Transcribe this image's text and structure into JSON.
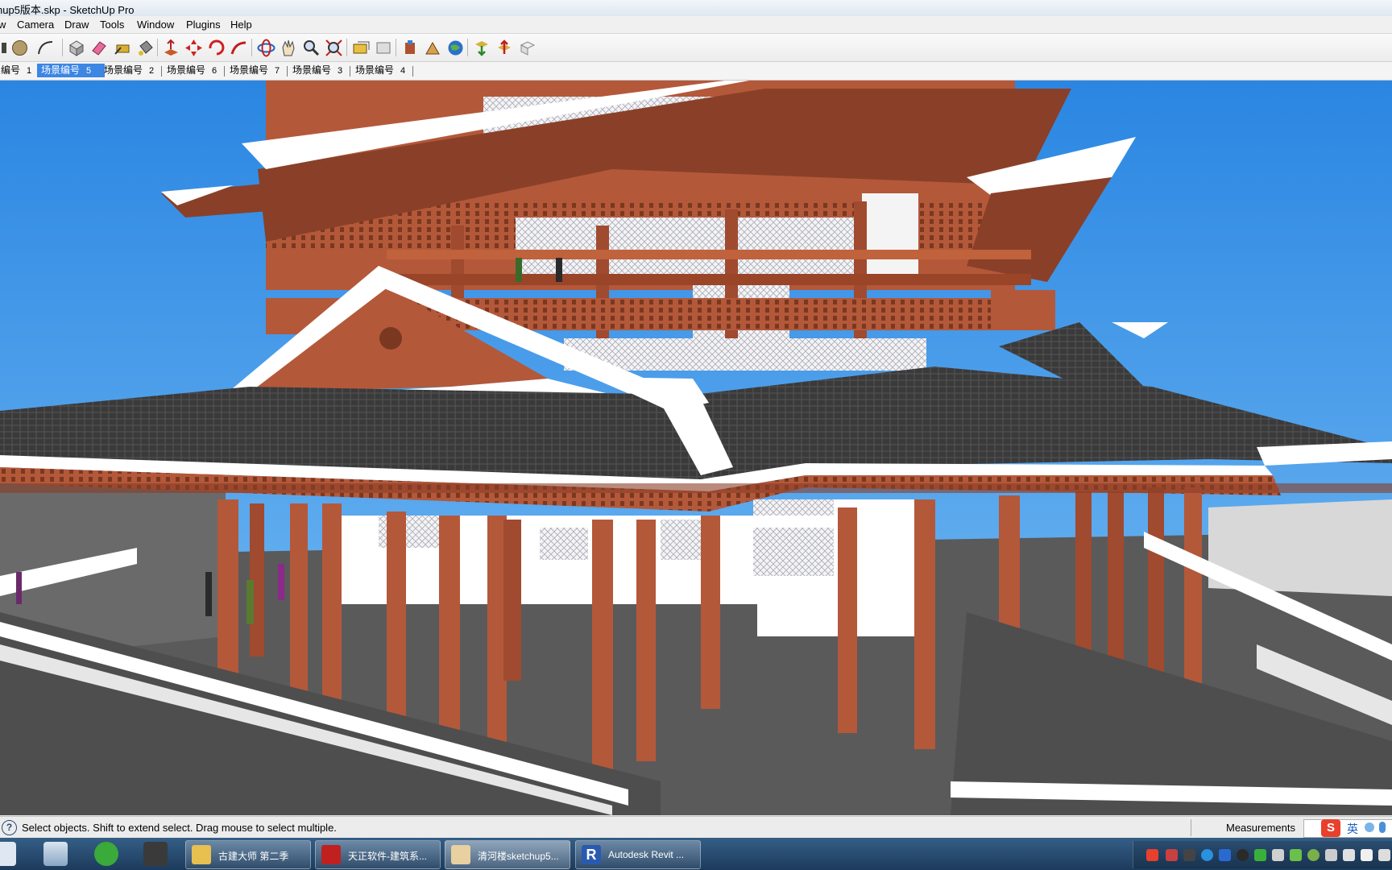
{
  "window": {
    "title": "hup5版本.skp - SketchUp Pro"
  },
  "menu": [
    "w",
    "Camera",
    "Draw",
    "Tools",
    "Window",
    "Plugins",
    "Help"
  ],
  "toolbar": {
    "icons": [
      "circle-tool-icon",
      "arc-tool-icon",
      "make-component-icon",
      "eraser-icon",
      "paint-bucket-icon",
      "tape-measure-icon",
      "push-pull-icon",
      "move-icon",
      "rotate-icon",
      "follow-me-icon",
      "orbit-icon",
      "pan-icon",
      "zoom-icon",
      "zoom-extents-icon",
      "previous-view-icon",
      "next-view-icon",
      "add-location-icon",
      "geo-toggle-terrain-icon",
      "google-earth-icon",
      "get-models-icon",
      "share-model-icon",
      "share-component-icon"
    ]
  },
  "scenes": [
    {
      "label": "编号",
      "num": "1",
      "active": false
    },
    {
      "label": "场景编号",
      "num": "5",
      "active": true
    },
    {
      "label": "场景编号",
      "num": "2",
      "active": false
    },
    {
      "label": "场景编号",
      "num": "6",
      "active": false
    },
    {
      "label": "场景编号",
      "num": "7",
      "active": false
    },
    {
      "label": "场景编号",
      "num": "3",
      "active": false
    },
    {
      "label": "场景编号",
      "num": "4",
      "active": false
    }
  ],
  "status": {
    "text": "Select objects. Shift to extend select. Drag mouse to select multiple.",
    "measurements_label": "Measurements",
    "ime_label": "英",
    "ime_icon": "S"
  },
  "taskbar": {
    "tasks": [
      {
        "label": "古建大师 第二季"
      },
      {
        "label": "天正软件-建筑系..."
      },
      {
        "label": "清河楼sketchup5..."
      },
      {
        "label": "Autodesk Revit ..."
      }
    ]
  },
  "colors": {
    "sky": "#2f8fe6",
    "timber": "#b4583a",
    "roof": "#3c3c3c",
    "wall": "#ffffff",
    "ground": "#5a5a5a"
  }
}
